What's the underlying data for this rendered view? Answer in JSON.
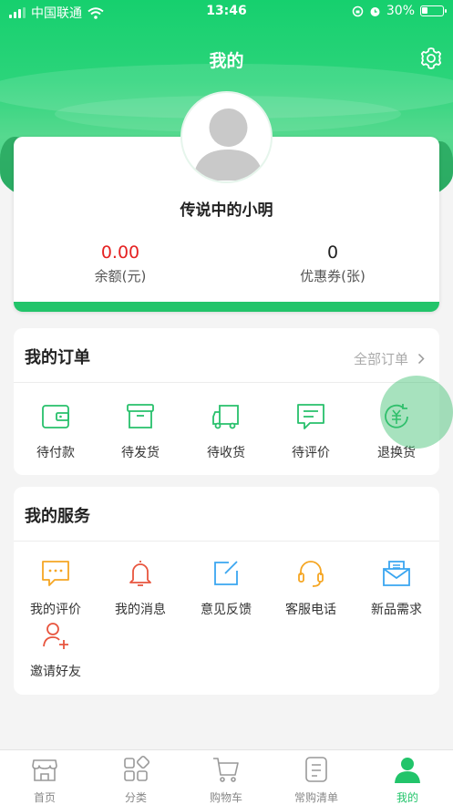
{
  "status_bar": {
    "carrier": "中国联通",
    "time": "13:46",
    "battery_percent": "30%",
    "battery_level": 0.3
  },
  "header": {
    "title": "我的"
  },
  "profile": {
    "name": "传说中的小明",
    "balance_value": "0.00",
    "balance_label": "余额(元)",
    "coupon_value": "0",
    "coupon_label": "优惠券(张)"
  },
  "orders": {
    "title": "我的订单",
    "all_orders_label": "全部订单",
    "items": [
      {
        "label": "待付款",
        "icon": "wallet-icon"
      },
      {
        "label": "待发货",
        "icon": "box-icon"
      },
      {
        "label": "待收货",
        "icon": "truck-icon"
      },
      {
        "label": "待评价",
        "icon": "comment-icon"
      },
      {
        "label": "退换货",
        "icon": "refund-icon"
      }
    ]
  },
  "services": {
    "title": "我的服务",
    "items": [
      {
        "label": "我的评价",
        "icon": "review-icon"
      },
      {
        "label": "我的消息",
        "icon": "bell-icon"
      },
      {
        "label": "意见反馈",
        "icon": "edit-icon"
      },
      {
        "label": "客服电话",
        "icon": "headset-icon"
      },
      {
        "label": "新品需求",
        "icon": "mail-icon"
      },
      {
        "label": "邀请好友",
        "icon": "add-user-icon"
      }
    ]
  },
  "tabbar": {
    "items": [
      {
        "label": "首页",
        "icon": "store-icon"
      },
      {
        "label": "分类",
        "icon": "category-icon"
      },
      {
        "label": "购物车",
        "icon": "cart-icon"
      },
      {
        "label": "常购清单",
        "icon": "list-icon"
      },
      {
        "label": "我的",
        "icon": "user-icon"
      }
    ],
    "active_index": 4
  },
  "colors": {
    "brand_green": "#22c46a",
    "balance_red": "#e52222",
    "order_icon": "#27c06b",
    "service_orange": "#f5a623",
    "service_red": "#e8553e",
    "service_blue": "#3aa6f0"
  }
}
